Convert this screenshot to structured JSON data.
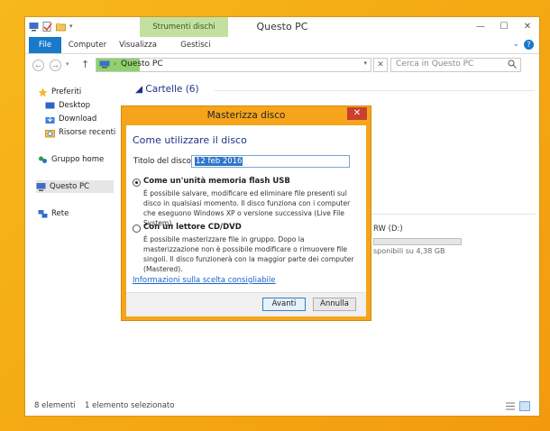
{
  "window": {
    "title": "Questo PC",
    "contextual_tab": "Strumenti dischi"
  },
  "ribbon": {
    "tabs": [
      "File",
      "Computer",
      "Visualizza",
      "Gestisci"
    ]
  },
  "address": {
    "path": "Questo PC",
    "search_placeholder": "Cerca in Questo PC"
  },
  "nav": {
    "items": [
      {
        "label": "Preferiti",
        "icon": "star-icon"
      },
      {
        "label": "Desktop",
        "icon": "desktop-icon"
      },
      {
        "label": "Download",
        "icon": "download-icon"
      },
      {
        "label": "Risorse recenti",
        "icon": "recent-places-icon"
      },
      {
        "label": "Gruppo home",
        "icon": "homegroup-icon"
      },
      {
        "label": "Questo PC",
        "icon": "computer-icon"
      },
      {
        "label": "Rete",
        "icon": "network-icon"
      }
    ]
  },
  "content": {
    "section_heading": "Cartelle (6)",
    "drive_name": "RW (D:)",
    "drive_free": "sponibili su 4,38 GB"
  },
  "status": {
    "count": "8 elementi",
    "selected": "1 elemento selezionato"
  },
  "dialog": {
    "title": "Masterizza disco",
    "heading": "Come utilizzare il disco",
    "title_label": "Titolo del disco:",
    "title_value": "12 feb 2016",
    "option1_title": "Come un'unità memoria flash USB",
    "option1_desc": "È possibile salvare, modificare ed eliminare file presenti sul disco in qualsiasi momento. Il disco funziona con i computer che eseguono Windows XP o versione successiva (Live File System).",
    "option2_title": "Con un lettore CD/DVD",
    "option2_desc": "È possibile masterizzare file in gruppo. Dopo la masterizzazione non è possibile modificare o rimuovere file singoli. Il disco funzionerà con la maggior parte dei computer (Mastered).",
    "help_link": "Informazioni sulla scelta consigliabile",
    "next_button": "Avanti",
    "cancel_button": "Annulla",
    "selected_option": 1
  },
  "colors": {
    "desktop": "#f4a812",
    "accent": "#1979ca",
    "contextual_tab": "#c4e0a1",
    "dialog_frame": "#f6a51b",
    "close_button": "#c9402f"
  }
}
